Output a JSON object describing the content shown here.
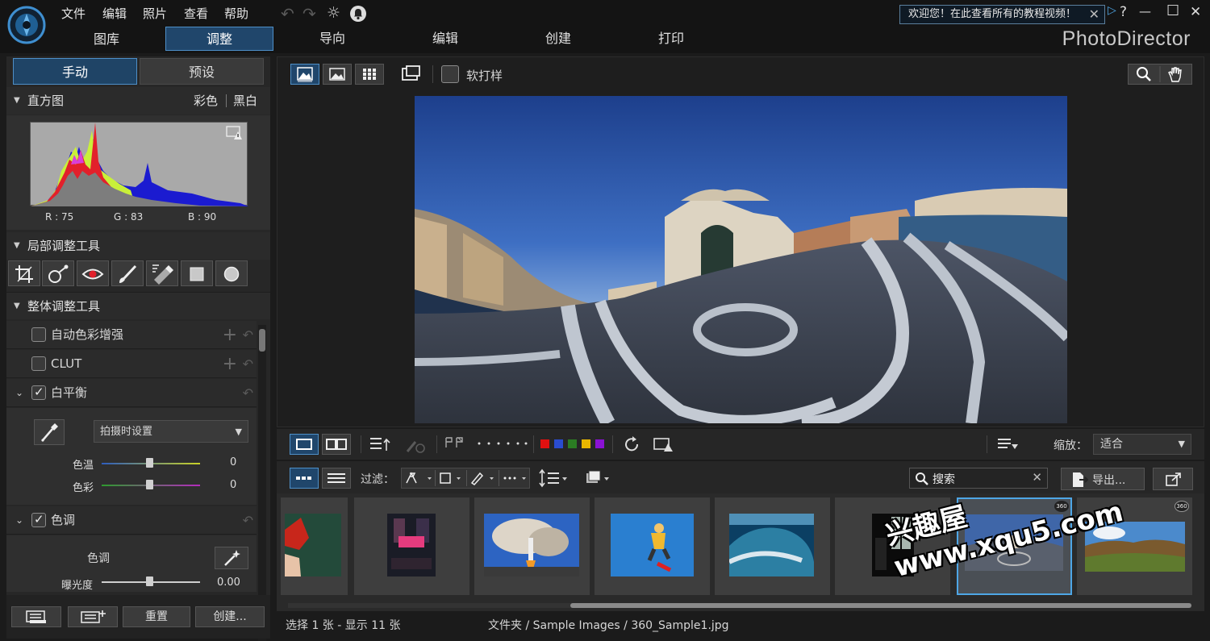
{
  "menu": [
    "文件",
    "编辑",
    "照片",
    "查看",
    "帮助"
  ],
  "nav_tabs": [
    "图库",
    "调整",
    "导向",
    "编辑",
    "创建",
    "打印"
  ],
  "brand": "PhotoDirector",
  "welcome": "欢迎您！在此查看所有的教程视频！",
  "window_controls": {
    "help": "?",
    "minimize": "—",
    "maximize": "☐",
    "close": "✕"
  },
  "left_tabs": {
    "manual": "手动",
    "preset": "预设"
  },
  "histogram": {
    "title": "直方图",
    "color": "彩色",
    "bw": "黑白",
    "r": "R : 75",
    "g": "G : 83",
    "b": "B : 90"
  },
  "local_tools_title": "局部调整工具",
  "global_tools_title": "整体调整工具",
  "rows": {
    "auto_color": "自动色彩增强",
    "clut": "CLUT",
    "white_balance": "白平衡",
    "tone": "色调"
  },
  "white_balance": {
    "mode": "拍摄时设置",
    "temp_label": "色温",
    "temp_value": "0",
    "tint_label": "色彩",
    "tint_value": "0"
  },
  "tone": {
    "label": "色调",
    "exposure_label": "曝光度",
    "exposure_value": "0.00"
  },
  "bottom_buttons": {
    "reset": "重置",
    "create": "创建..."
  },
  "viewer": {
    "softproof": "软打样"
  },
  "toolbar2": {
    "zoom_label": "缩放：",
    "zoom_value": "适合"
  },
  "toolbar3": {
    "filter_label": "过滤：",
    "search_placeholder": "搜索",
    "export": "导出..."
  },
  "status": {
    "selection": "选择 1 张 - 显示 11 张",
    "path": "文件夹 / Sample Images / 360_Sample1.jpg"
  },
  "badge_360": "360",
  "watermark": "兴趣屋 www.xqu5.com",
  "colors": {
    "accent": "#4ea6e6",
    "active_tab": "#20466b",
    "label_red": "#e01010",
    "label_blue": "#2a4ccf",
    "label_green": "#2b7d23",
    "label_yellow": "#e8b600",
    "label_purple": "#8a12d3"
  }
}
